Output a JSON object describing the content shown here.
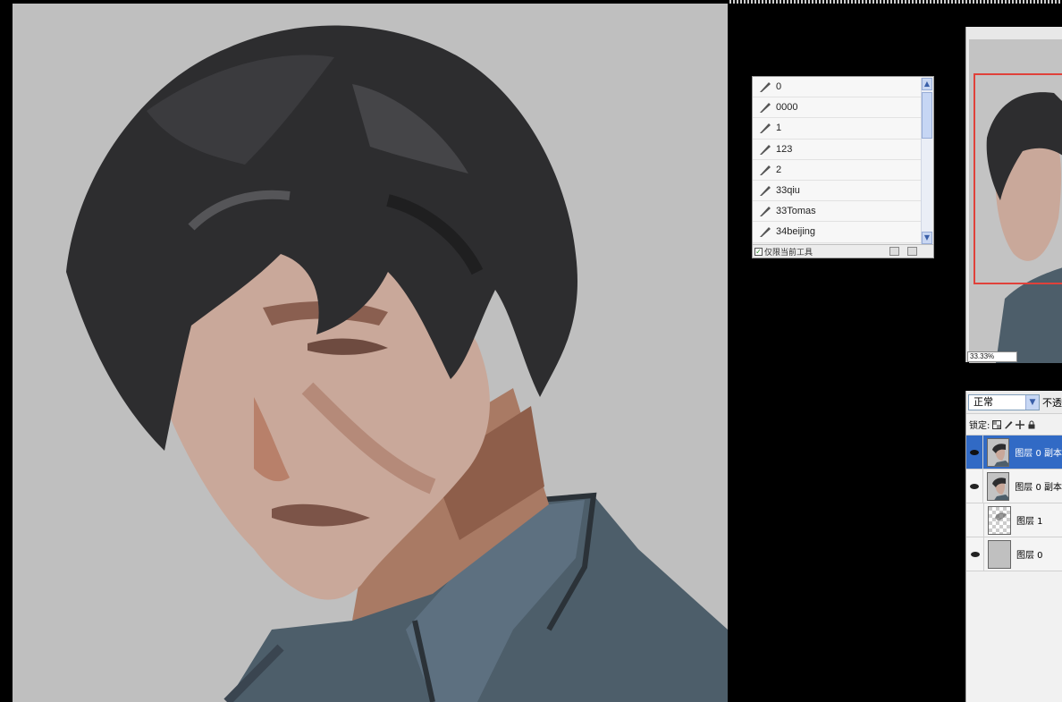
{
  "brush_panel": {
    "presets": [
      {
        "name": "0"
      },
      {
        "name": "0000"
      },
      {
        "name": "1"
      },
      {
        "name": "123"
      },
      {
        "name": "2"
      },
      {
        "name": "33qiu"
      },
      {
        "name": "33Tomas"
      },
      {
        "name": "34beijing"
      }
    ],
    "current_tool_only_label": "仅限当前工具",
    "current_tool_only_checked": true
  },
  "navigator": {
    "zoom": "33.33%"
  },
  "layers": {
    "blend_mode": "正常",
    "opacity_label": "不透",
    "lock_label": "锁定:",
    "items": [
      {
        "name": "图层 0 副本",
        "visible": true,
        "selected": true
      },
      {
        "name": "图层 0 副本",
        "visible": true,
        "selected": false
      },
      {
        "name": "图层 1",
        "visible": false,
        "selected": false
      },
      {
        "name": "图层 0",
        "visible": true,
        "selected": false
      }
    ]
  },
  "colors": {
    "selection_blue": "#316ac5",
    "navigator_frame": "#e0413a",
    "canvas_gray": "#bfbfbf"
  }
}
